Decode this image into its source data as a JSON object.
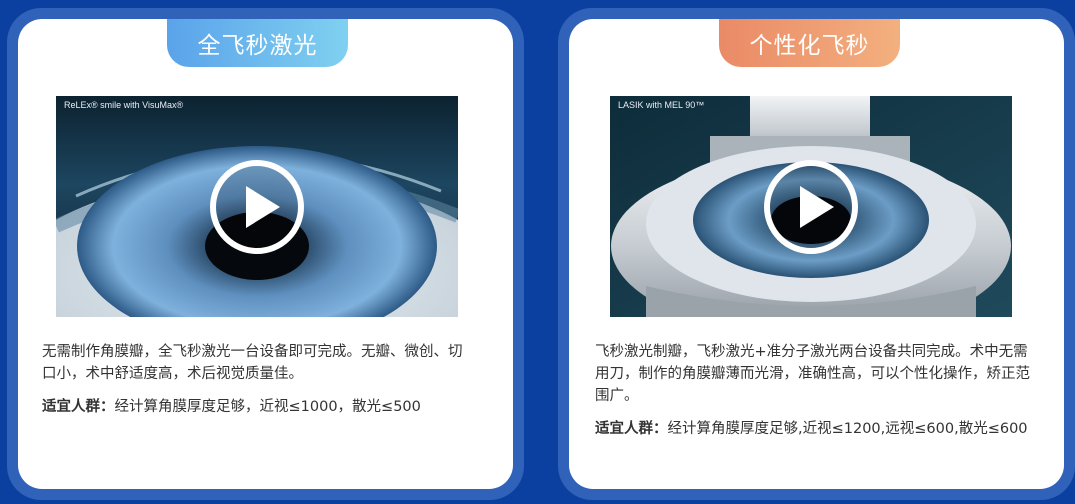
{
  "cards": [
    {
      "tab_title": "全飞秒激光",
      "video_caption": "ReLEx® smile with VisuMax®",
      "description": "无需制作角膜瓣，全飞秒激光一台设备即可完成。无瓣、微创、切口小，术中舒适度高，术后视觉质量佳。",
      "fit_label": "适宜人群：",
      "fit_text": "经计算角膜厚度足够，近视≤1000，散光≤500"
    },
    {
      "tab_title": "个性化飞秒",
      "video_caption": "LASIK with MEL 90™",
      "description": "飞秒激光制瓣，飞秒激光+准分子激光两台设备共同完成。术中无需用刀，制作的角膜瓣薄而光滑，准确性高，可以个性化操作，矫正范围广。",
      "fit_label": "适宜人群：",
      "fit_text": "经计算角膜厚度足够,近视≤1200,远视≤600,散光≤600"
    }
  ],
  "icons": {
    "play": "play-circle-icon"
  },
  "colors": {
    "background": "#0b3fa0",
    "card_border": "#2f62b8",
    "tab_blue": "#5aa3ea",
    "tab_orange": "#ea8a66"
  }
}
